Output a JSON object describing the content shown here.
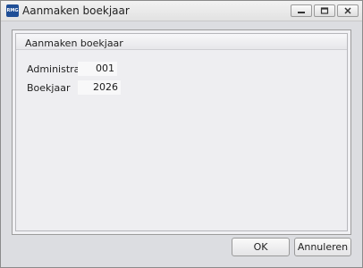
{
  "window": {
    "title": "Aanmaken boekjaar",
    "app_icon_text": "RMG"
  },
  "group": {
    "title": "Aanmaken boekjaar"
  },
  "fields": {
    "administratie": {
      "label": "Administratie",
      "value": "001"
    },
    "boekjaar": {
      "label": "Boekjaar",
      "value": "2026"
    }
  },
  "buttons": {
    "ok": "OK",
    "cancel": "Annuleren"
  },
  "colors": {
    "app_icon": "#1f4e96",
    "window_bg": "#dcdde1"
  },
  "icons": {
    "minimize": "minimize-icon",
    "maximize": "maximize-icon",
    "close": "close-icon"
  }
}
